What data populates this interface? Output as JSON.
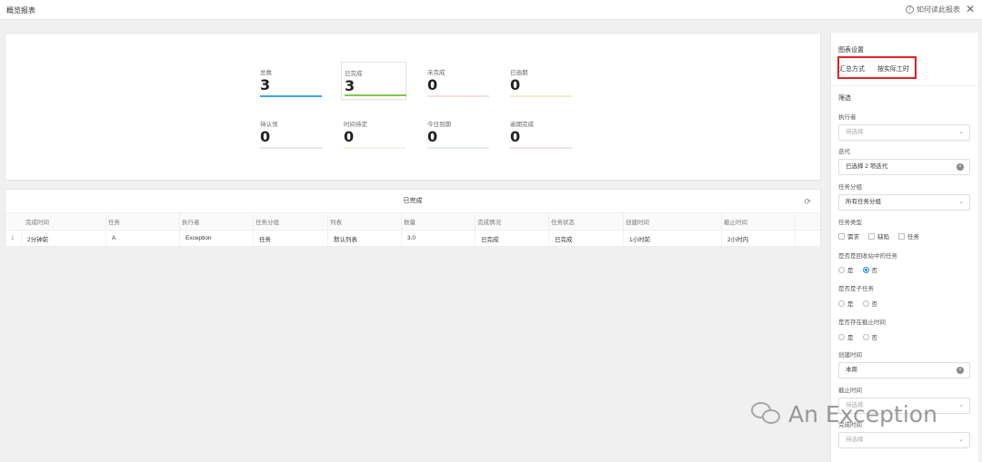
{
  "header": {
    "title": "概览报表",
    "help_label": "如何读此报表",
    "help_icon": "question-circle-icon",
    "close_icon": "close-icon"
  },
  "stats": [
    {
      "label": "总数",
      "value": "3",
      "color": "#3ba1ff",
      "active": false
    },
    {
      "label": "已完成",
      "value": "3",
      "color": "#7ec850",
      "active": true
    },
    {
      "label": "未完成",
      "value": "0",
      "color": "#f6e0d8",
      "active": false
    },
    {
      "label": "已逾期",
      "value": "0",
      "color": "#f3ead0",
      "active": false
    },
    {
      "label": "待认领",
      "value": "0",
      "color": "#e6e6e6",
      "active": false
    },
    {
      "label": "时间待定",
      "value": "0",
      "color": "#eef3df",
      "active": false
    },
    {
      "label": "今日到期",
      "value": "0",
      "color": "#e3ecf6",
      "active": false
    },
    {
      "label": "逾期完成",
      "value": "0",
      "color": "#f6dfe0",
      "active": false
    }
  ],
  "table": {
    "title": "已完成",
    "refresh_icon": "refresh-icon",
    "columns": [
      "完成时间",
      "任务",
      "执行者",
      "任务分组",
      "列表",
      "数量",
      "完成情况",
      "任务状态",
      "创建时间",
      "截止时间"
    ],
    "rows": [
      {
        "index": "1",
        "cells": [
          "2分钟前",
          "A",
          "Exception",
          "任务",
          "默认列表",
          "3.0",
          "已完成",
          "已完成",
          "1小时前",
          "2小时内"
        ]
      }
    ]
  },
  "sidebar": {
    "chart_settings": "图表设置",
    "aggregate_label": "汇总方式",
    "aggregate_value": "按实际工时",
    "filter_heading": "筛选",
    "executor": {
      "label": "执行者",
      "placeholder": "待选择"
    },
    "iteration": {
      "label": "迭代",
      "value": "已选择 2 项迭代"
    },
    "task_group": {
      "label": "任务分组",
      "value": "所有任务分组"
    },
    "task_type": {
      "label": "任务类型",
      "options": [
        "需求",
        "缺陷",
        "任务"
      ]
    },
    "recycle": {
      "label": "是否是回收站中的任务",
      "options": [
        "是",
        "否"
      ],
      "selected": "否"
    },
    "subtask": {
      "label": "是否是子任务",
      "options": [
        "是",
        "否"
      ],
      "selected": ""
    },
    "has_deadline": {
      "label": "是否存在截止时间",
      "options": [
        "是",
        "否"
      ],
      "selected": ""
    },
    "created_time": {
      "label": "创建时间",
      "value": "本周"
    },
    "deadline": {
      "label": "截止时间",
      "placeholder": "待选择"
    },
    "completed_time": {
      "label": "完成时间",
      "placeholder": "待选择"
    }
  },
  "watermark": {
    "text": "An Exception",
    "icon": "wechat-icon"
  }
}
